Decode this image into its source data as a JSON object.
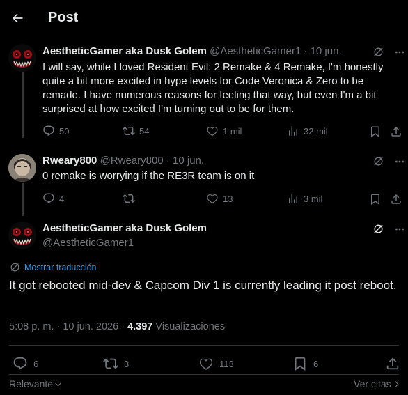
{
  "header": {
    "title": "Post"
  },
  "tweets": [
    {
      "display_name": "AestheticGamer aka Dusk Golem",
      "handle": "@AestheticGamer1",
      "dot": "·",
      "date": "10 jun.",
      "text": "I will say, while I loved Resident Evil: 2 Remake & 4 Remake, I'm honestly quite a bit more excited in hype levels for Code Veronica & Zero to be remade. I have numerous reasons for feeling that way, but even I'm a bit surprised at how excited I'm turning out to be for them.",
      "replies": "50",
      "reposts": "54",
      "likes": "1 mil",
      "views": "32 mil"
    },
    {
      "display_name": "Rweary800",
      "handle": "@Rweary800",
      "dot": "·",
      "date": "10 jun.",
      "text": "0 remake is worrying if the RE3R team is on it",
      "replies": "4",
      "reposts": "",
      "likes": "13",
      "views": "3 mil"
    }
  ],
  "main_post": {
    "display_name": "AestheticGamer aka Dusk Golem",
    "handle": "@AestheticGamer1",
    "translate_label": "Mostrar traducción",
    "text": "It got rebooted mid-dev & Capcom Div 1 is currently leading it post reboot.",
    "time": "5:08 p. m. · 10 jun. 2026 · ",
    "views_count": "4.397",
    "views_label": " Visualizaciones",
    "replies": "6",
    "reposts": "3",
    "likes": "113",
    "bookmarks": "6"
  },
  "footer": {
    "sort_label": "Relevante",
    "quotes_label": "Ver citas"
  },
  "colors": {
    "background": "#000000",
    "text": "#e7e9ea",
    "muted": "#71767b",
    "accent": "#1d9bf0",
    "divider": "#2f3336"
  }
}
